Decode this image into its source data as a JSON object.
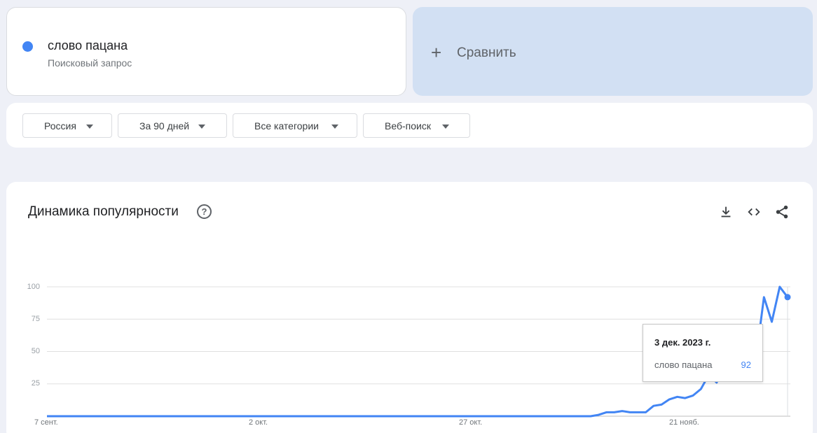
{
  "search_term": {
    "label": "слово пацана",
    "subtitle": "Поисковый запрос",
    "color": "#4285f4"
  },
  "compare": {
    "icon": "plus-icon",
    "label": "Сравнить"
  },
  "filters": [
    {
      "label": "Россия"
    },
    {
      "label": "За 90 дней"
    },
    {
      "label": "Все категории"
    },
    {
      "label": "Веб-поиск"
    }
  ],
  "chart_section": {
    "title": "Динамика популярности",
    "help_icon": "help-circle-icon",
    "actions": [
      "download-icon",
      "embed-code-icon",
      "share-icon"
    ]
  },
  "chart_data": {
    "type": "line",
    "xlabel": "",
    "ylabel": "",
    "ylim": [
      0,
      100
    ],
    "y_ticks": [
      "100",
      "75",
      "50",
      "25"
    ],
    "x_ticks": [
      "7 сент.",
      "2 окт.",
      "27 окт.",
      "21 нояб."
    ],
    "grid": true,
    "series": [
      {
        "name": "слово пацана",
        "color": "#4285f4",
        "values": [
          0,
          0,
          0,
          0,
          0,
          0,
          0,
          0,
          0,
          0,
          0,
          0,
          0,
          0,
          0,
          0,
          0,
          0,
          0,
          0,
          0,
          0,
          0,
          0,
          0,
          0,
          0,
          0,
          0,
          0,
          0,
          0,
          0,
          0,
          0,
          0,
          0,
          0,
          0,
          0,
          0,
          0,
          0,
          0,
          0,
          0,
          0,
          0,
          0,
          0,
          0,
          0,
          0,
          0,
          0,
          0,
          0,
          0,
          0,
          0,
          0,
          0,
          0,
          0,
          0,
          0,
          0,
          0,
          0,
          0,
          1,
          3,
          3,
          4,
          3,
          3,
          3,
          8,
          9,
          13,
          15,
          14,
          16,
          21,
          32,
          26,
          40,
          40,
          38,
          40,
          45,
          92,
          73,
          100,
          92
        ]
      }
    ]
  },
  "tooltip": {
    "date": "3 дек. 2023 г.",
    "term": "слово пацана",
    "value": "92"
  }
}
